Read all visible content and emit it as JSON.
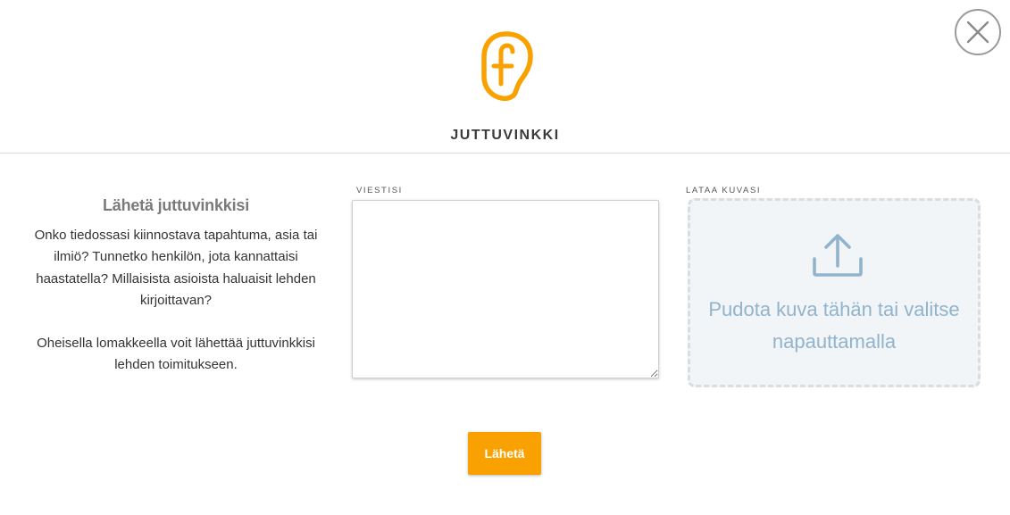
{
  "header": {
    "title": "JUTTUVINKKI",
    "logo_icon": "ear-icon",
    "brand_color": "#f9a100",
    "close_icon": "close-icon"
  },
  "intro": {
    "heading": "Lähetä juttuvinkkisi",
    "paragraph1": "Onko tiedossasi kiinnostava tapahtuma, asia tai ilmiö? Tunnetko henkilön, jota kannattaisi haastatella? Millaisista asioista haluaisit lehden kirjoittavan?",
    "paragraph2": "Oheisella lomakkeella voit lähettää juttuvinkkisi lehden toimitukseen."
  },
  "message_field": {
    "label": "VIESTISI",
    "value": ""
  },
  "upload": {
    "label": "LATAA KUVASI",
    "icon": "upload-icon",
    "text": "Pudota kuva tähän tai valitse napauttamalla",
    "text_color": "#92b3cc"
  },
  "submit": {
    "label": "Lähetä"
  }
}
